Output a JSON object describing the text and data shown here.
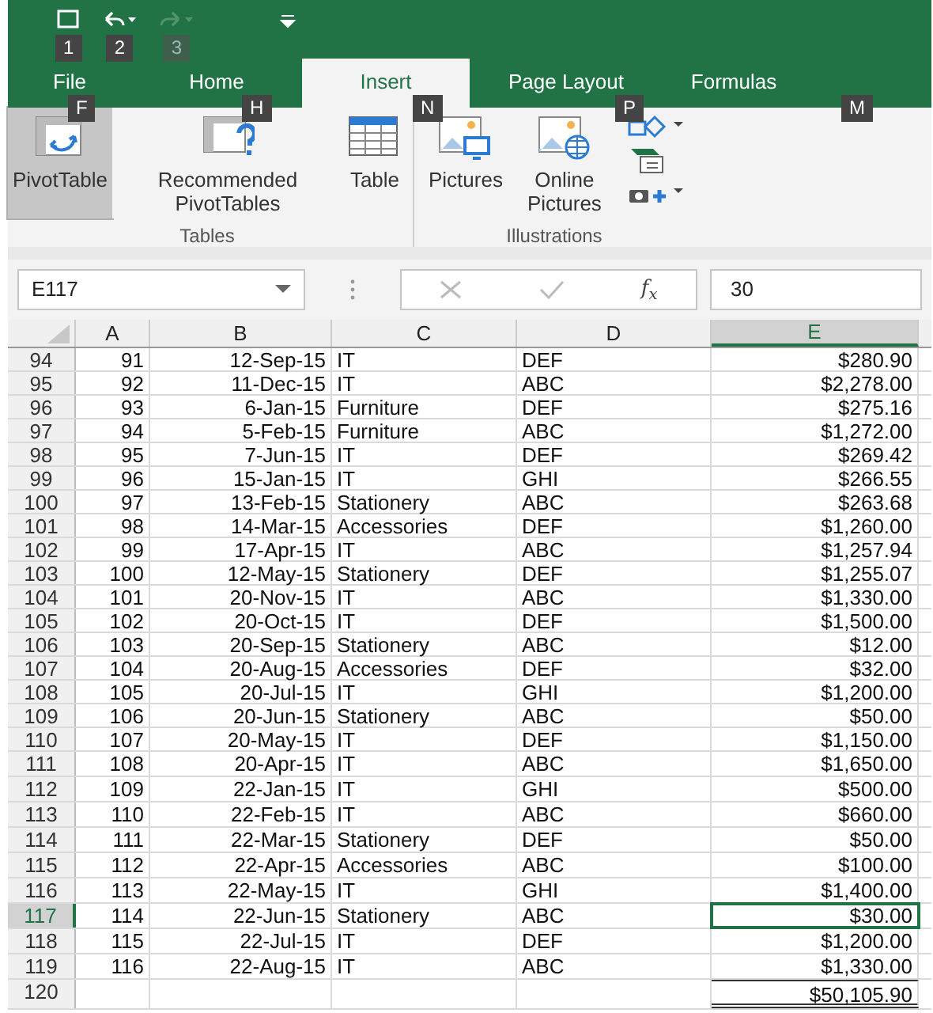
{
  "quick_access": [
    {
      "kind": "save",
      "keytip": "1",
      "disabled": false
    },
    {
      "kind": "undo",
      "keytip": "2",
      "disabled": false
    },
    {
      "kind": "redo",
      "keytip": "3",
      "disabled": true
    },
    {
      "kind": "customize",
      "disabled": false
    }
  ],
  "tabs": [
    {
      "label": "File",
      "keytip": "F",
      "selected": false
    },
    {
      "label": "Home",
      "keytip": "H",
      "selected": false
    },
    {
      "label": "Insert",
      "keytip": "N",
      "selected": true
    },
    {
      "label": "Page Layout",
      "keytip": "P",
      "selected": false
    },
    {
      "label": "Formulas",
      "keytip": "M",
      "selected": false
    }
  ],
  "ribbon": {
    "groups": [
      {
        "label": "Tables",
        "buttons": [
          {
            "kind": "pivot",
            "label": "PivotTable",
            "selected": true
          },
          {
            "kind": "recommended",
            "label": "Recommended PivotTables",
            "selected": false
          },
          {
            "kind": "table",
            "label": "Table",
            "selected": false
          }
        ]
      },
      {
        "label": "Illustrations",
        "buttons": [
          {
            "kind": "pictures",
            "label": "Pictures",
            "selected": false
          },
          {
            "kind": "online",
            "label": "Online Pictures",
            "selected": false
          },
          {
            "kind": "small",
            "selected": false
          }
        ]
      }
    ]
  },
  "name_box": "E117",
  "function_symbol": "f$_{x}$",
  "formula": "30",
  "columns": [
    {
      "label": "A",
      "selected": false
    },
    {
      "label": "B",
      "selected": false
    },
    {
      "label": "C",
      "selected": false
    },
    {
      "label": "D",
      "selected": false
    },
    {
      "label": "E",
      "selected": true
    }
  ],
  "rows": [
    {
      "row": "94",
      "cells": [
        "91",
        "12-Sep-15",
        "IT",
        "DEF",
        "$280.90"
      ],
      "selected": false
    },
    {
      "row": "95",
      "cells": [
        "92",
        "11-Dec-15",
        "IT",
        "ABC",
        "$2,278.00"
      ],
      "selected": false
    },
    {
      "row": "96",
      "cells": [
        "93",
        "6-Jan-15",
        "Furniture",
        "DEF",
        "$275.16"
      ],
      "selected": false
    },
    {
      "row": "97",
      "cells": [
        "94",
        "5-Feb-15",
        "Furniture",
        "ABC",
        "$1,272.00"
      ],
      "selected": false
    },
    {
      "row": "98",
      "cells": [
        "95",
        "7-Jun-15",
        "IT",
        "DEF",
        "$269.42"
      ],
      "selected": false
    },
    {
      "row": "99",
      "cells": [
        "96",
        "15-Jan-15",
        "IT",
        "GHI",
        "$266.55"
      ],
      "selected": false
    },
    {
      "row": "100",
      "cells": [
        "97",
        "13-Feb-15",
        "Stationery",
        "ABC",
        "$263.68"
      ],
      "selected": false
    },
    {
      "row": "101",
      "cells": [
        "98",
        "14-Mar-15",
        "Accessories",
        "DEF",
        "$1,260.00"
      ],
      "selected": false
    },
    {
      "row": "102",
      "cells": [
        "99",
        "17-Apr-15",
        "IT",
        "ABC",
        "$1,257.94"
      ],
      "selected": false
    },
    {
      "row": "103",
      "cells": [
        "100",
        "12-May-15",
        "Stationery",
        "DEF",
        "$1,255.07"
      ],
      "selected": false
    },
    {
      "row": "104",
      "cells": [
        "101",
        "20-Nov-15",
        "IT",
        "ABC",
        "$1,330.00"
      ],
      "selected": false
    },
    {
      "row": "105",
      "cells": [
        "102",
        "20-Oct-15",
        "IT",
        "DEF",
        "$1,500.00"
      ],
      "selected": false
    },
    {
      "row": "106",
      "cells": [
        "103",
        "20-Sep-15",
        "Stationery",
        "ABC",
        "$12.00"
      ],
      "selected": false
    },
    {
      "row": "107",
      "cells": [
        "104",
        "20-Aug-15",
        "Accessories",
        "DEF",
        "$32.00"
      ],
      "selected": false
    },
    {
      "row": "108",
      "cells": [
        "105",
        "20-Jul-15",
        "IT",
        "GHI",
        "$1,200.00"
      ],
      "selected": false
    },
    {
      "row": "109",
      "cells": [
        "106",
        "20-Jun-15",
        "Stationery",
        "ABC",
        "$50.00"
      ],
      "selected": false
    },
    {
      "row": "110",
      "cells": [
        "107",
        "20-May-15",
        "IT",
        "DEF",
        "$1,150.00"
      ],
      "selected": false
    },
    {
      "row": "111",
      "cells": [
        "108",
        "20-Apr-15",
        "IT",
        "ABC",
        "$1,650.00"
      ],
      "selected": false
    },
    {
      "row": "112",
      "cells": [
        "109",
        "22-Jan-15",
        "IT",
        "GHI",
        "$500.00"
      ],
      "selected": false
    },
    {
      "row": "113",
      "cells": [
        "110",
        "22-Feb-15",
        "IT",
        "ABC",
        "$660.00"
      ],
      "selected": false
    },
    {
      "row": "114",
      "cells": [
        "111",
        "22-Mar-15",
        "Stationery",
        "DEF",
        "$50.00"
      ],
      "selected": false
    },
    {
      "row": "115",
      "cells": [
        "112",
        "22-Apr-15",
        "Accessories",
        "ABC",
        "$100.00"
      ],
      "selected": false
    },
    {
      "row": "116",
      "cells": [
        "113",
        "22-May-15",
        "IT",
        "GHI",
        "$1,400.00"
      ],
      "selected": false
    },
    {
      "row": "117",
      "cells": [
        "114",
        "22-Jun-15",
        "Stationery",
        "ABC",
        "$30.00"
      ],
      "selected": true
    },
    {
      "row": "118",
      "cells": [
        "115",
        "22-Jul-15",
        "IT",
        "DEF",
        "$1,200.00"
      ],
      "selected": false
    },
    {
      "row": "119",
      "cells": [
        "116",
        "22-Aug-15",
        "IT",
        "ABC",
        "$1,330.00"
      ],
      "selected": false
    },
    {
      "row": "120",
      "cells": [
        "",
        "",
        "",
        "",
        "$50,105.90"
      ],
      "selected": false,
      "total": true
    }
  ]
}
